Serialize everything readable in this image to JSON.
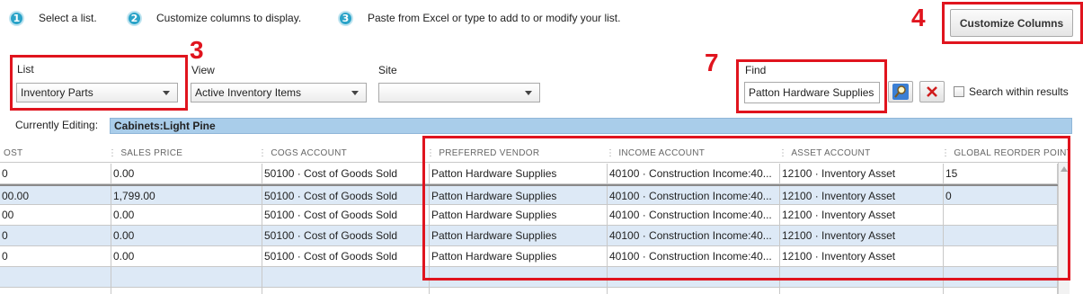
{
  "steps": [
    {
      "num": "1",
      "text": "Select a list."
    },
    {
      "num": "2",
      "text": "Customize columns to display."
    },
    {
      "num": "3",
      "text": "Paste from Excel or type to add to or modify your list."
    }
  ],
  "annotations": {
    "n3": "3",
    "n4": "4",
    "n7": "7"
  },
  "customize_button": "Customize Columns",
  "filters": {
    "list_label": "List",
    "list_value": "Inventory Parts",
    "view_label": "View",
    "view_value": "Active Inventory Items",
    "site_label": "Site",
    "site_value": "",
    "find_label": "Find",
    "find_value": "Patton Hardware Supplies",
    "search_within": "Search within results"
  },
  "editing": {
    "label": "Currently Editing:",
    "value": "Cabinets:Light Pine"
  },
  "grid": {
    "columns": [
      "OST",
      "SALES PRICE",
      "COGS ACCOUNT",
      "PREFERRED VENDOR",
      "INCOME ACCOUNT",
      "ASSET ACCOUNT",
      "GLOBAL REORDER POINT"
    ],
    "rows": [
      [
        "0",
        "0.00",
        "50100 · Cost of Goods Sold",
        "Patton Hardware Supplies",
        "40100 · Construction Income:40...",
        "12100 · Inventory Asset",
        "15"
      ],
      [
        "00.00",
        "1,799.00",
        "50100 · Cost of Goods Sold",
        "Patton Hardware Supplies",
        "40100 · Construction Income:40...",
        "12100 · Inventory Asset",
        "0"
      ],
      [
        "00",
        "0.00",
        "50100 · Cost of Goods Sold",
        "Patton Hardware Supplies",
        "40100 · Construction Income:40...",
        "12100 · Inventory Asset",
        ""
      ],
      [
        "0",
        "0.00",
        "50100 · Cost of Goods Sold",
        "Patton Hardware Supplies",
        "40100 · Construction Income:40...",
        "12100 · Inventory Asset",
        ""
      ],
      [
        "0",
        "0.00",
        "50100 · Cost of Goods Sold",
        "Patton Hardware Supplies",
        "40100 · Construction Income:40...",
        "12100 · Inventory Asset",
        ""
      ],
      [
        "",
        "",
        "",
        "",
        "",
        "",
        ""
      ],
      [
        "",
        "",
        "",
        "",
        "",
        "",
        ""
      ]
    ]
  },
  "colors": {
    "annotation_red": "#e0141e",
    "step_icon": "#2aa3c8",
    "row_alt": "#dde9f6",
    "editing_bar": "#a9cdea"
  }
}
